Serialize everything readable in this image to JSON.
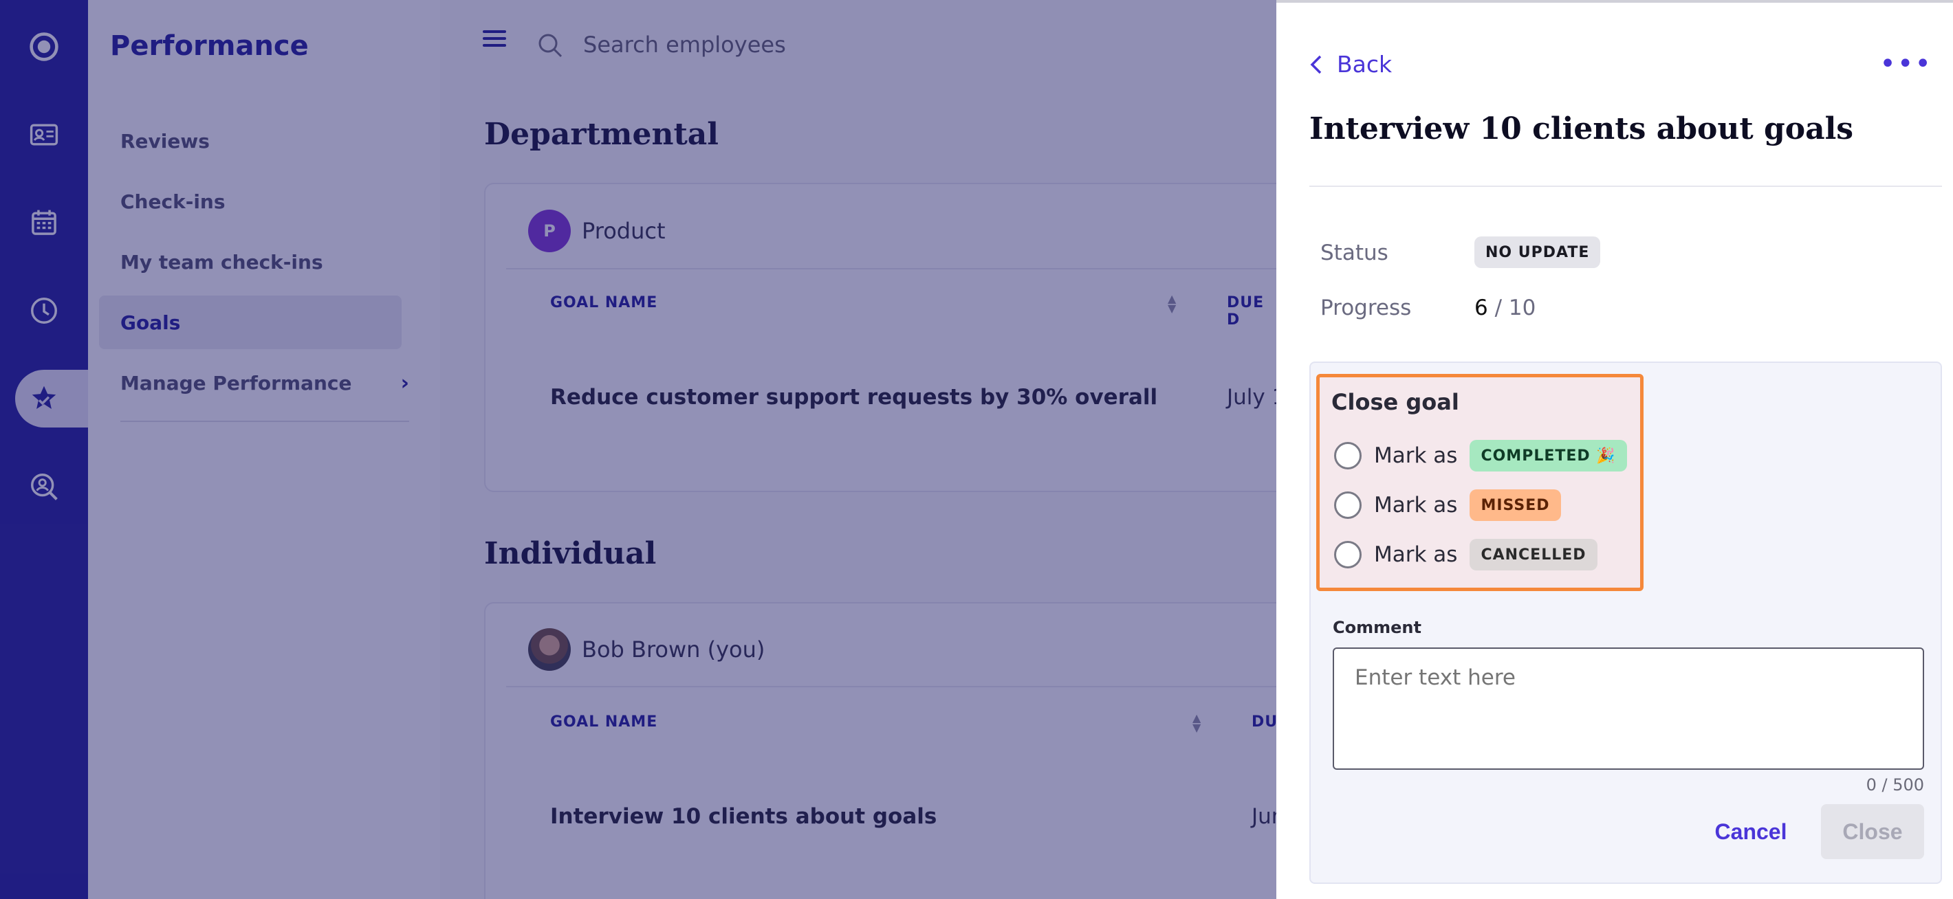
{
  "nav": {
    "title": "Performance",
    "items": [
      {
        "label": "Reviews"
      },
      {
        "label": "Check-ins"
      },
      {
        "label": "My team check-ins"
      },
      {
        "label": "Goals"
      },
      {
        "label": "Manage Performance"
      }
    ],
    "active": "Goals"
  },
  "topbar": {
    "search_placeholder": "Search employees"
  },
  "sections": {
    "departmental": {
      "title": "Departmental",
      "group": "Product",
      "avatar_letter": "P",
      "column_goal": "GOAL NAME",
      "column_due": "DUE D",
      "row_goal": "Reduce customer support requests by 30% overall",
      "row_due": "July 1"
    },
    "individual": {
      "title": "Individual",
      "person": "Bob Brown (you)",
      "column_goal": "GOAL NAME",
      "column_due": "DU",
      "row_goal": "Interview 10 clients about goals",
      "row_due": "Jun"
    }
  },
  "drawer": {
    "back_label": "Back",
    "more_label": "•••",
    "title": "Interview 10 clients about goals",
    "status_label": "Status",
    "status_value": "NO UPDATE",
    "progress_label": "Progress",
    "progress_current": "6",
    "progress_total": " / 10",
    "progress": {
      "current": 6,
      "total": 10
    },
    "close_goal": {
      "title": "Close goal",
      "options": [
        {
          "prefix": "Mark as",
          "badge": "COMPLETED 🎉",
          "color": "#a6e8c0"
        },
        {
          "prefix": "Mark as",
          "badge": "MISSED",
          "color": "#ffb98a"
        },
        {
          "prefix": "Mark as",
          "badge": "CANCELLED",
          "color": "#ddd8d8"
        }
      ]
    },
    "comment": {
      "label": "Comment",
      "placeholder": "Enter text here",
      "value": "",
      "counter": "0 / 500"
    },
    "cancel_label": "Cancel",
    "close_label": "Close"
  },
  "colors": {
    "brand": "#1b1796",
    "accent": "#4a35d8",
    "highlight_border": "#f5883a"
  },
  "icons": [
    "logo-icon",
    "id-card-icon",
    "calendar-icon",
    "clock-icon",
    "star-badge-icon",
    "people-search-icon",
    "menu-icon",
    "search-icon",
    "chevron-left-icon",
    "chevron-right-icon",
    "more-icon",
    "sort-icon"
  ]
}
